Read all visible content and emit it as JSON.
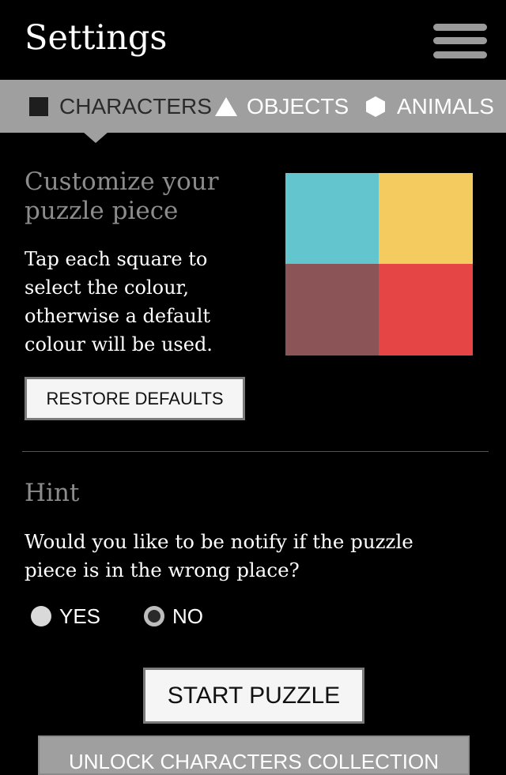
{
  "header": {
    "title": "Settings",
    "menu_icon": "hamburger-menu-icon"
  },
  "tabs": [
    {
      "label": "CHARACTERS",
      "icon": "square-icon",
      "active": true
    },
    {
      "label": "OBJECTS",
      "icon": "triangle-icon",
      "active": false
    },
    {
      "label": "ANIMALS",
      "icon": "hexagon-icon",
      "active": false
    }
  ],
  "customize": {
    "title_line1": "Customize your",
    "title_line2": "puzzle piece",
    "desc_lines": [
      "Tap each square to",
      "select the colour,",
      "otherwise a default",
      "colour will be used."
    ],
    "colors": [
      "#63c6ce",
      "#f3cb5e",
      "#8b5457",
      "#e64545"
    ],
    "restore_label": "RESTORE DEFAULTS"
  },
  "hint": {
    "title": "Hint",
    "question_line1": "Would you like to be notify if the puzzle",
    "question_line2": "piece is in the wrong place?",
    "options": [
      {
        "label": "YES",
        "selected": false
      },
      {
        "label": "NO",
        "selected": true
      }
    ]
  },
  "actions": {
    "start_label": "START PUZZLE",
    "unlock_label": "UNLOCK CHARACTERS COLLECTION"
  }
}
